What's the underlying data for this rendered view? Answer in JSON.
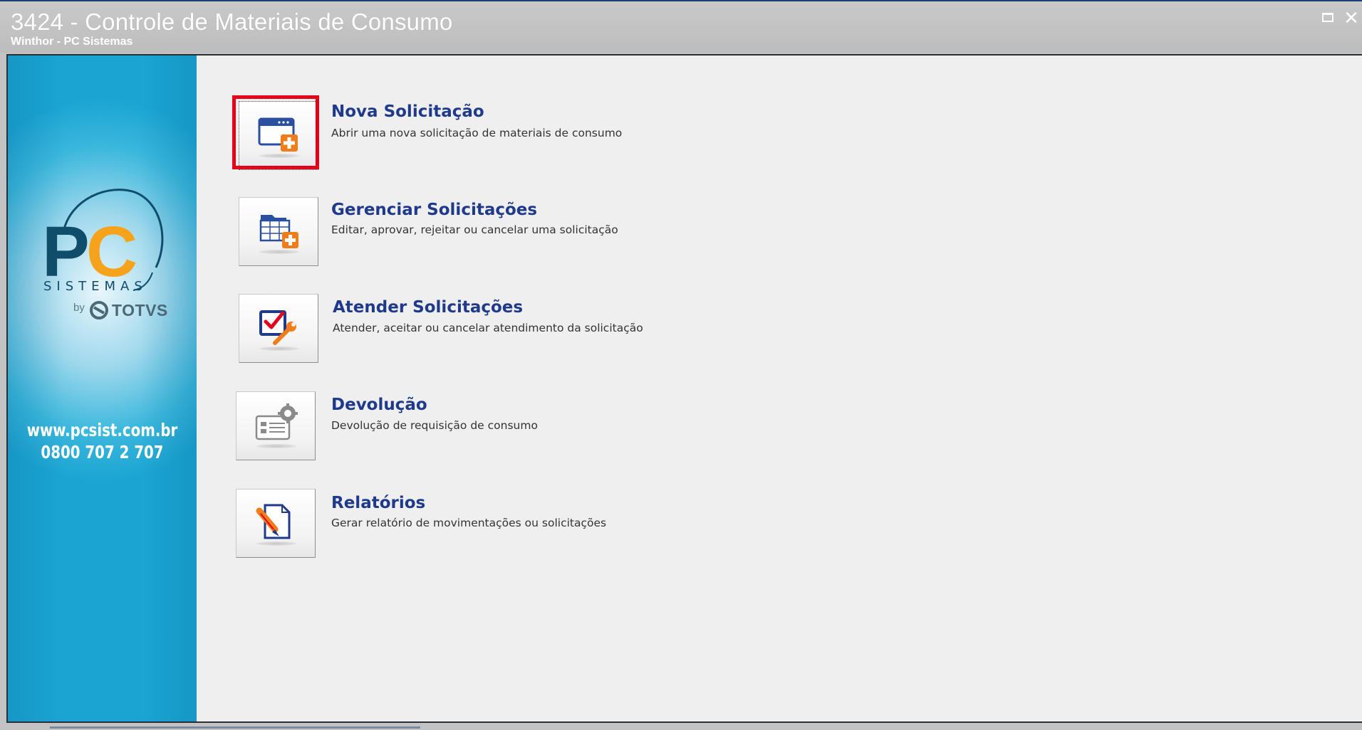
{
  "window": {
    "title": "3424 - Controle de Materiais de Consumo",
    "subtitle": "Winthor - PC Sistemas",
    "maximize_glyph": "□",
    "close_glyph": "✕"
  },
  "sidebar": {
    "logo_letters": "PC",
    "logo_word": "SISTEMAS",
    "logo_by": "by",
    "logo_brand": "TOTVS",
    "website": "www.pcsist.com.br",
    "phone": "0800 707 2 707",
    "colors": {
      "cyan": "#1ba4d2",
      "logo_blue": "#0f4d6b",
      "logo_orange": "#f7a21b"
    }
  },
  "menu": {
    "items": [
      {
        "title": "Nova Solicitação",
        "description": "Abrir uma nova solicitação de materiais de consumo",
        "icon": "new-request-icon",
        "selected": true
      },
      {
        "title": "Gerenciar Solicitações",
        "description": "Editar, aprovar, rejeitar ou cancelar uma solicitação",
        "icon": "manage-requests-icon",
        "selected": false
      },
      {
        "title": "Atender Solicitações",
        "description": "Atender, aceitar ou cancelar atendimento da solicitação",
        "icon": "fulfill-requests-icon",
        "selected": false
      },
      {
        "title": "Devolução",
        "description": "Devolução de requisição de consumo",
        "icon": "return-icon",
        "selected": false
      },
      {
        "title": "Relatórios",
        "description": "Gerar relatório de movimentações ou solicitações",
        "icon": "reports-icon",
        "selected": false
      }
    ]
  },
  "colors": {
    "title_blue": "#1f3a8a",
    "highlight_red": "#e5001a",
    "accent_orange": "#f07c1a"
  }
}
